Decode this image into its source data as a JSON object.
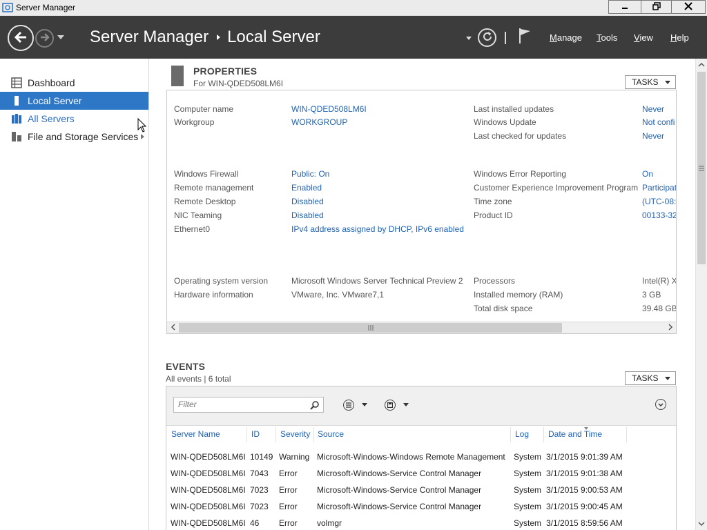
{
  "window": {
    "title": "Server Manager",
    "icon": "server-manager-icon"
  },
  "header": {
    "breadcrumb": [
      "Server Manager",
      "Local Server"
    ],
    "menu": [
      {
        "label": "Manage",
        "underline": "M",
        "rest": "anage"
      },
      {
        "label": "Tools",
        "underline": "T",
        "rest": "ools"
      },
      {
        "label": "View",
        "underline": "V",
        "rest": "iew"
      },
      {
        "label": "Help",
        "underline": "H",
        "rest": "elp"
      }
    ]
  },
  "sidebar": {
    "items": [
      {
        "label": "Dashboard",
        "icon": "dashboard-icon",
        "state": "normal"
      },
      {
        "label": "Local Server",
        "icon": "server-icon",
        "state": "active"
      },
      {
        "label": "All Servers",
        "icon": "servers-icon",
        "state": "link"
      },
      {
        "label": "File and Storage Services",
        "icon": "storage-icon",
        "state": "normal",
        "expandable": true
      }
    ]
  },
  "properties": {
    "title": "PROPERTIES",
    "subtitle": "For WIN-QDED508LM6I",
    "tasks_label": "TASKS",
    "left_group1": [
      {
        "label": "Computer name",
        "value": "WIN-QDED508LM6I"
      },
      {
        "label": "Workgroup",
        "value": "WORKGROUP"
      }
    ],
    "right_group1": [
      {
        "label": "Last installed updates",
        "value": "Never"
      },
      {
        "label": "Windows Update",
        "value": "Not confi"
      },
      {
        "label": "Last checked for updates",
        "value": "Never"
      }
    ],
    "left_group2": [
      {
        "label": "Windows Firewall",
        "value": "Public: On"
      },
      {
        "label": "Remote management",
        "value": "Enabled"
      },
      {
        "label": "Remote Desktop",
        "value": "Disabled"
      },
      {
        "label": "NIC Teaming",
        "value": "Disabled"
      },
      {
        "label": "Ethernet0",
        "value": "IPv4 address assigned by DHCP, IPv6 enabled"
      }
    ],
    "right_group2": [
      {
        "label": "Windows Error Reporting",
        "value": "On"
      },
      {
        "label": "Customer Experience Improvement Program",
        "value": "Participat"
      },
      {
        "label": "Time zone",
        "value": "(UTC-08:0"
      },
      {
        "label": "Product ID",
        "value": "00133-32"
      }
    ],
    "left_group3": [
      {
        "label": "Operating system version",
        "value": "Microsoft Windows Server Technical Preview 2"
      },
      {
        "label": "Hardware information",
        "value": "VMware, Inc. VMware7,1"
      }
    ],
    "right_group3": [
      {
        "label": "Processors",
        "value": "Intel(R) X"
      },
      {
        "label": "Installed memory (RAM)",
        "value": "3 GB"
      },
      {
        "label": "Total disk space",
        "value": "39.48 GB"
      }
    ]
  },
  "events": {
    "title": "EVENTS",
    "subtitle": "All events | 6 total",
    "tasks_label": "TASKS",
    "filter_placeholder": "Filter",
    "columns": [
      "Server Name",
      "ID",
      "Severity",
      "Source",
      "Log",
      "Date and Time"
    ],
    "rows": [
      [
        "WIN-QDED508LM6I",
        "10149",
        "Warning",
        "Microsoft-Windows-Windows Remote Management",
        "System",
        "3/1/2015 9:01:39 AM"
      ],
      [
        "WIN-QDED508LM6I",
        "7043",
        "Error",
        "Microsoft-Windows-Service Control Manager",
        "System",
        "3/1/2015 9:01:38 AM"
      ],
      [
        "WIN-QDED508LM6I",
        "7023",
        "Error",
        "Microsoft-Windows-Service Control Manager",
        "System",
        "3/1/2015 9:00:53 AM"
      ],
      [
        "WIN-QDED508LM6I",
        "7023",
        "Error",
        "Microsoft-Windows-Service Control Manager",
        "System",
        "3/1/2015 9:00:45 AM"
      ],
      [
        "WIN-QDED508LM6I",
        "46",
        "Error",
        "volmgr",
        "System",
        "3/1/2015 8:59:56 AM"
      ]
    ]
  },
  "colors": {
    "header_bg": "#3c3c3c",
    "accent": "#2e77c7",
    "link": "#1f62b4"
  }
}
